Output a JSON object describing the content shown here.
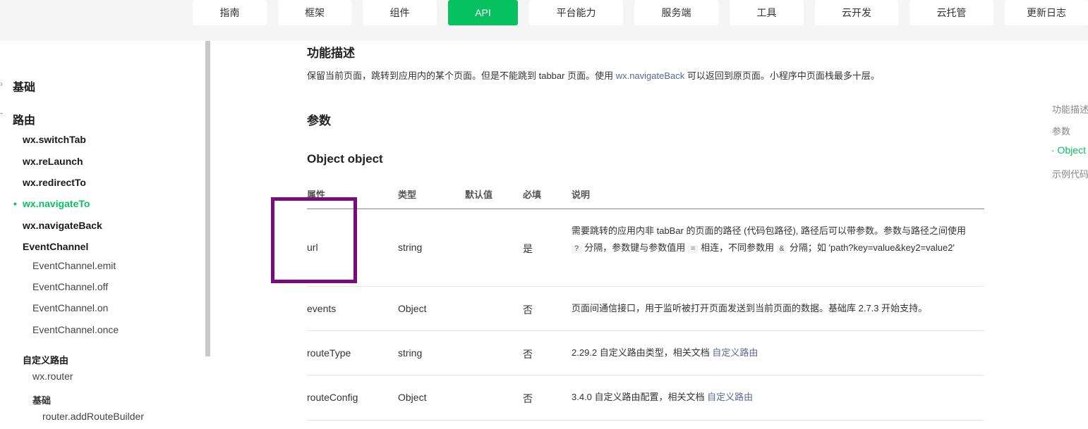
{
  "nav": {
    "tabs": [
      {
        "label": "指南"
      },
      {
        "label": "框架"
      },
      {
        "label": "组件"
      },
      {
        "label": "API"
      },
      {
        "label": "平台能力"
      },
      {
        "label": "服务端"
      },
      {
        "label": "工具"
      },
      {
        "label": "云开发"
      },
      {
        "label": "云托管"
      },
      {
        "label": "更新日志"
      }
    ]
  },
  "sidebar": {
    "section_basic": "基础",
    "section_route": "路由",
    "items": [
      "wx.switchTab",
      "wx.reLaunch",
      "wx.redirectTo",
      "wx.navigateTo",
      "wx.navigateBack",
      "EventChannel",
      "EventChannel.emit",
      "EventChannel.off",
      "EventChannel.on",
      "EventChannel.once",
      "自定义路由",
      "wx.router",
      "基础",
      "router.addRouteBuilder"
    ]
  },
  "content": {
    "section_desc_title": "功能描述",
    "desc_before": "保留当前页面，跳转到应用内的某个页面。但是不能跳到 tabbar 页面。使用 ",
    "desc_link": "wx.navigateBack",
    "desc_after": " 可以返回到原页面。小程序中页面栈最多十层。",
    "params_title": "参数",
    "object_title": "Object object",
    "table": {
      "headers": [
        "属性",
        "类型",
        "默认值",
        "必填",
        "说明"
      ],
      "rows": [
        {
          "attr": "url",
          "type": "string",
          "default": "",
          "required": "是",
          "desc_1": "需要跳转的应用内非 tabBar 的页面的路径 (代码包路径), 路径后可以带参数。参数与路径之间使用 ",
          "code_1": "?",
          "desc_2": " 分隔，参数键与参数值用 ",
          "code_2": "=",
          "desc_3": " 相连，不同参数用 ",
          "code_3": "&",
          "desc_4": " 分隔；如 'path?key=value&key2=value2'"
        },
        {
          "attr": "events",
          "type": "Object",
          "default": "",
          "required": "否",
          "desc": "页面间通信接口，用于监听被打开页面发送到当前页面的数据。基础库 2.7.3 开始支持。"
        },
        {
          "attr": "routeType",
          "type": "string",
          "default": "",
          "required": "否",
          "desc": "2.29.2 自定义路由类型，相关文档 ",
          "link": "自定义路由"
        },
        {
          "attr": "routeConfig",
          "type": "Object",
          "default": "",
          "required": "否",
          "desc": "3.4.0 自定义路由配置，相关文档 ",
          "link": "自定义路由"
        }
      ]
    }
  },
  "toc": {
    "items": [
      "功能描述",
      "参数",
      "· Object",
      "示例代码"
    ]
  },
  "colors": {
    "accent": "#07c160",
    "link": "#576b95",
    "highlight_box": "#7a0a7e"
  }
}
